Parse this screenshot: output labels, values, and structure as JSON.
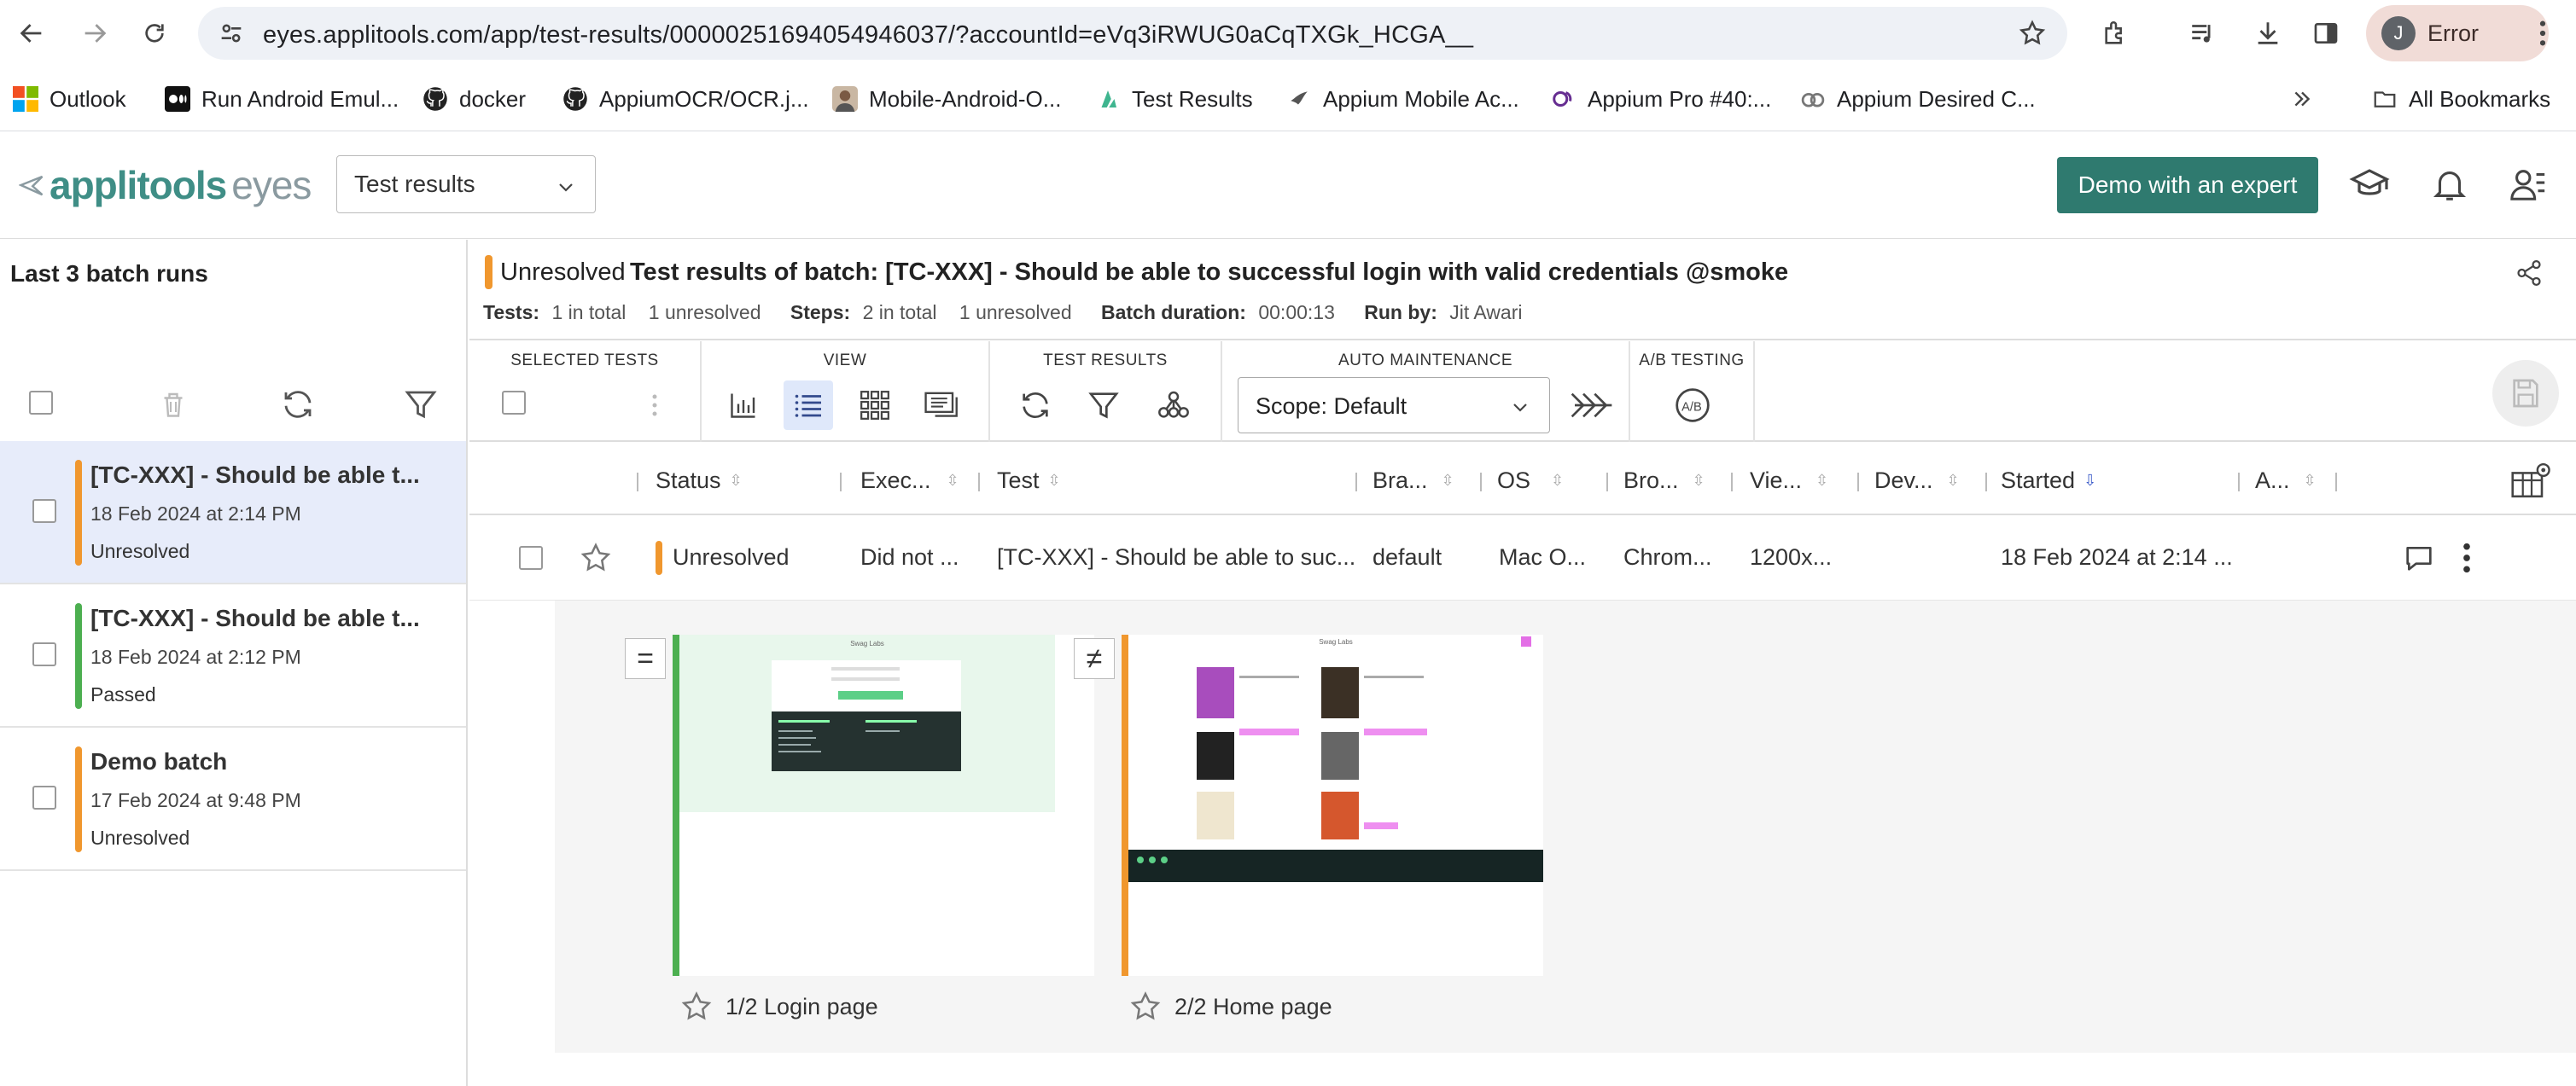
{
  "browser": {
    "url": "eyes.applitools.com/app/test-results/00000251694054946037/?accountId=eVq3iRWUG0aCqTXGk_HCGA__",
    "profile_initial": "J",
    "profile_label": "Error"
  },
  "bookmarks": {
    "items": [
      {
        "label": "Outlook",
        "icon": "outlook-icon"
      },
      {
        "label": "Run Android Emul...",
        "icon": "medium-icon"
      },
      {
        "label": "docker",
        "icon": "github-icon"
      },
      {
        "label": "AppiumOCR/OCR.j...",
        "icon": "github-icon"
      },
      {
        "label": "Mobile-Android-O...",
        "icon": "avatar-icon"
      },
      {
        "label": "Test Results",
        "icon": "applitools-icon"
      },
      {
        "label": "Appium Mobile Ac...",
        "icon": "appium-icon"
      },
      {
        "label": "Appium Pro #40:...",
        "icon": "appium-pro-icon"
      },
      {
        "label": "Appium Desired C...",
        "icon": "appium-icon"
      }
    ],
    "all_label": "All Bookmarks"
  },
  "app": {
    "logo_brand": "applitools",
    "logo_product": "eyes",
    "view_select": "Test results",
    "demo_button": "Demo with an expert"
  },
  "left_panel": {
    "title": "Last 3 batch runs",
    "batches": [
      {
        "title": "[TC-XXX] - Should be able t...",
        "date": "18 Feb 2024 at 2:14 PM",
        "status": "Unresolved",
        "color": "#f0972e"
      },
      {
        "title": "[TC-XXX] - Should be able t...",
        "date": "18 Feb 2024 at 2:12 PM",
        "status": "Passed",
        "color": "#4caf50"
      },
      {
        "title": "Demo batch",
        "date": "17 Feb 2024 at 9:48 PM",
        "status": "Unresolved",
        "color": "#f0972e"
      }
    ]
  },
  "batch": {
    "status": "Unresolved",
    "title": "Test results of batch:  [TC-XXX] - Should be able to successful login with valid credentials @smoke",
    "tests_label": "Tests:",
    "tests_total": "1 in total",
    "tests_unresolved": "1 unresolved",
    "steps_label": "Steps:",
    "steps_total": "2 in total",
    "steps_unresolved": "1 unresolved",
    "duration_label": "Batch duration:",
    "duration": "00:00:13",
    "runby_label": "Run by:",
    "runby": "Jit Awari"
  },
  "toolbar": {
    "selected_tests": "SELECTED TESTS",
    "view": "VIEW",
    "test_results": "TEST RESULTS",
    "auto_maintenance": "AUTO MAINTENANCE",
    "ab_testing": "A/B TESTING",
    "scope": "Scope: Default"
  },
  "table": {
    "columns": [
      "Status",
      "Exec...",
      "Test",
      "Bra...",
      "OS",
      "Bro...",
      "Vie...",
      "Dev...",
      "Started",
      "A..."
    ],
    "row": {
      "status": "Unresolved",
      "exec": "Did not ...",
      "test": "[TC-XXX] - Should be able to suc...",
      "branch": "default",
      "os": "Mac O...",
      "browser": "Chrom...",
      "viewport": "1200x...",
      "started": "18 Feb 2024 at 2:14 ..."
    }
  },
  "steps": [
    {
      "label": "1/2 Login page",
      "sign": "=",
      "color": "#4caf50",
      "mini_title": "Swag Labs"
    },
    {
      "label": "2/2 Home page",
      "sign": "≠",
      "color": "#f0972e",
      "mini_title": "Swag Labs"
    }
  ]
}
